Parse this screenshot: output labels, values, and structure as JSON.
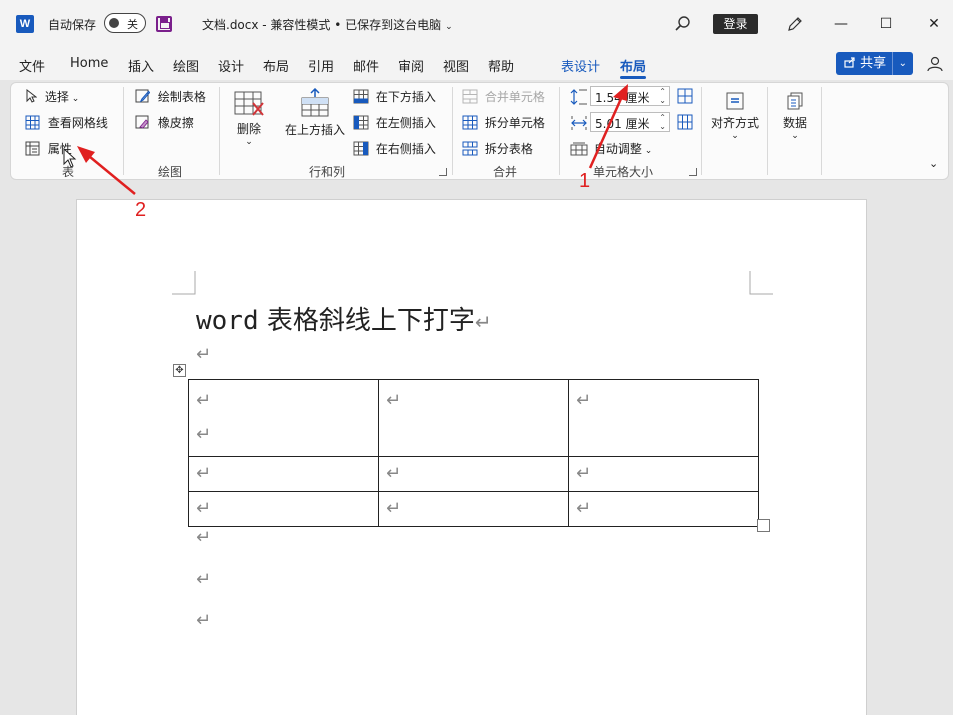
{
  "titlebar": {
    "app_icon_letter": "W",
    "autosave_label": "自动保存",
    "autosave_state": "关",
    "document_title": "文档.docx  -  兼容性模式 • 已保存到这台电脑",
    "title_caret": "⌄",
    "login_label": "登录",
    "minimize_glyph": "—",
    "maximize_glyph": "☐",
    "close_glyph": "✕"
  },
  "tabs": {
    "items": [
      "文件",
      "Home",
      "插入",
      "绘图",
      "设计",
      "布局",
      "引用",
      "邮件",
      "审阅",
      "视图",
      "帮助"
    ],
    "context_tab": "表设计",
    "active_tab": "布局",
    "share_label": "共享",
    "share_chevron": "⌄"
  },
  "ribbon": {
    "table_group": {
      "select": "选择",
      "view_gridlines": "查看网格线",
      "properties": "属性",
      "label": "表"
    },
    "draw_group": {
      "draw_table": "绘制表格",
      "eraser": "橡皮擦",
      "label": "绘图"
    },
    "rows_cols_group": {
      "delete": "删除",
      "insert_above": "在上方插入",
      "insert_below": "在下方插入",
      "insert_left": "在左侧插入",
      "insert_right": "在右侧插入",
      "label": "行和列"
    },
    "merge_group": {
      "merge_cells": "合并单元格",
      "split_cells": "拆分单元格",
      "split_table": "拆分表格",
      "label": "合并"
    },
    "cell_size_group": {
      "height_value": "1.54 厘米",
      "width_value": "5.01 厘米",
      "autofit": "自动调整",
      "label": "单元格大小"
    },
    "alignment": "对齐方式",
    "data": "数据",
    "collapse_glyph": "⌄"
  },
  "document": {
    "heading_word": "word",
    "heading_text": " 表格斜线上下打字",
    "paragraph_mark": "↵",
    "move_handle_glyph": "✥",
    "table": [
      [
        "↵\n↵",
        "↵",
        "↵"
      ],
      [
        "↵",
        "↵",
        "↵"
      ],
      [
        "↵",
        "↵",
        "↵"
      ]
    ]
  },
  "annotations": {
    "arrow_color": "#e02020",
    "label_1": "1",
    "label_2": "2"
  },
  "colors": {
    "accent": "#185abd",
    "delete_red": "#d13438"
  }
}
